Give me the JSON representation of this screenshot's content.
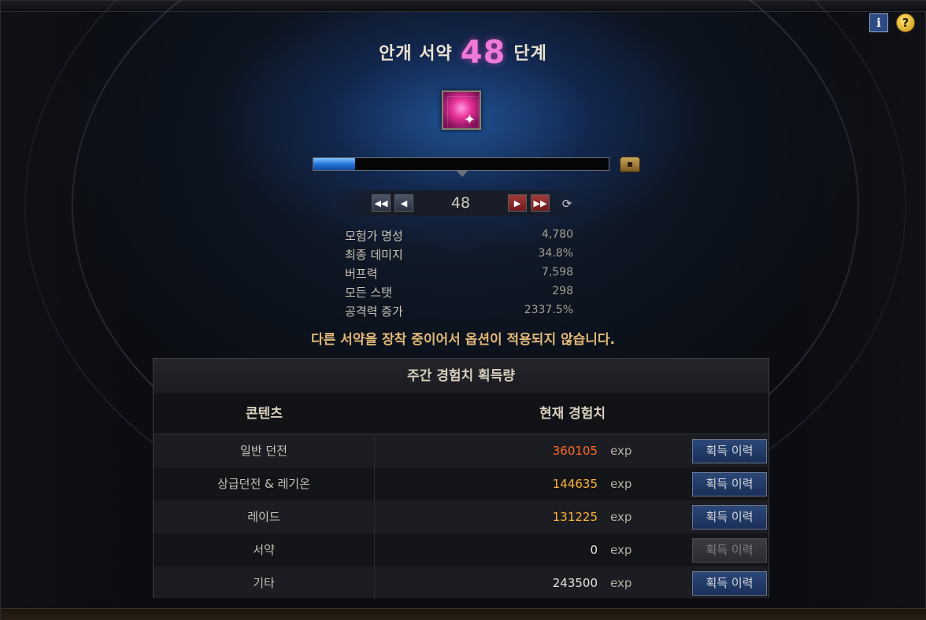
{
  "header": {
    "title_prefix": "안개 서약",
    "level": "48",
    "title_suffix": "단계"
  },
  "progress": {
    "fraction": 0.14
  },
  "level_nav": {
    "current": "48"
  },
  "stats": [
    {
      "name": "모험가 명성",
      "value": "4,780"
    },
    {
      "name": "최종 데미지",
      "value": "34.8%"
    },
    {
      "name": "버프력",
      "value": "7,598"
    },
    {
      "name": "모든 스탯",
      "value": "298"
    },
    {
      "name": "공격력 증가",
      "value": "2337.5%"
    }
  ],
  "warning": "다른 서약을 장착 중이어서 옵션이 적용되지 않습니다.",
  "exp_table": {
    "title": "주간 경험치 획득량",
    "col_content": "콘텐츠",
    "col_exp": "현재 경험치",
    "unit": "exp",
    "history_label": "획득 이력",
    "rows": [
      {
        "name": "일반 던전",
        "value": "360105",
        "color": "#ff6a2a",
        "enabled": true
      },
      {
        "name": "상급던전 & 레기온",
        "value": "144635",
        "color": "#ffb13a",
        "enabled": true
      },
      {
        "name": "레이드",
        "value": "131225",
        "color": "#ffb13a",
        "enabled": true
      },
      {
        "name": "서약",
        "value": "0",
        "color": "#e8e4dc",
        "enabled": false
      },
      {
        "name": "기타",
        "value": "243500",
        "color": "#e8e4dc",
        "enabled": true
      }
    ]
  },
  "icons": {
    "info": "i",
    "help": "?",
    "first": "◀◀",
    "prev": "◀",
    "next": "▶",
    "last": "▶▶",
    "refresh": "⟳"
  },
  "colors": {
    "level_pink": "#f07ad8",
    "warning": "#e2b878",
    "progress_blue": "#1e6fd6"
  }
}
